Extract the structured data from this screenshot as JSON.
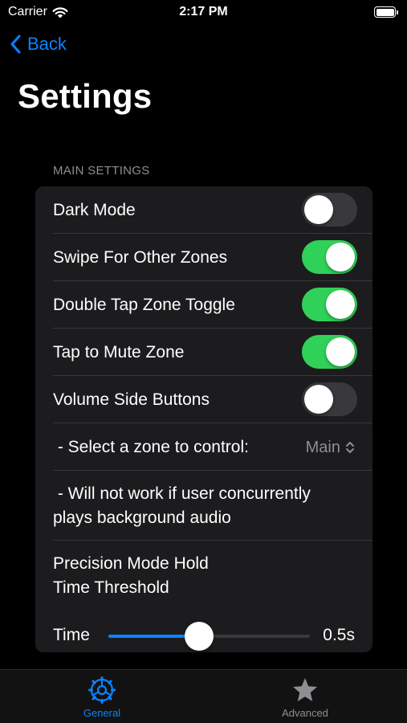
{
  "status_bar": {
    "carrier": "Carrier",
    "time": "2:17 PM"
  },
  "nav": {
    "back_label": "Back",
    "title": "Settings"
  },
  "section": {
    "header": "MAIN SETTINGS"
  },
  "rows": {
    "dark_mode": {
      "label": "Dark Mode",
      "on": false
    },
    "swipe": {
      "label": "Swipe For Other Zones",
      "on": true
    },
    "double_tap": {
      "label": "Double Tap Zone Toggle",
      "on": true
    },
    "tap_mute": {
      "label": "Tap to Mute Zone",
      "on": true
    },
    "volume_buttons": {
      "label": "Volume Side Buttons",
      "on": false
    },
    "select_zone": {
      "label": " - Select a zone to control:",
      "value": "Main"
    },
    "note_line1": " - Will not work if user concurrently",
    "note_line2": "plays background audio",
    "precision_line1": "Precision Mode Hold",
    "precision_line2": "Time Threshold",
    "time": {
      "label": "Time",
      "value": "0.5s",
      "fraction": 0.45
    }
  },
  "tabs": [
    {
      "label": "General",
      "icon": "gear-icon",
      "active": true
    },
    {
      "label": "Advanced",
      "icon": "star-icon",
      "active": false
    }
  ],
  "colors": {
    "accent": "#0a84ff",
    "toggle_on": "#30d158",
    "background": "#000000",
    "card": "#1c1c1e"
  }
}
